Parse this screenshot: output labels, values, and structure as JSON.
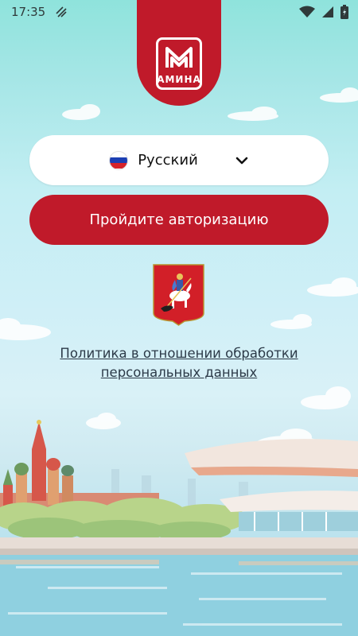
{
  "status_bar": {
    "time": "17:35",
    "left_icon": "no-sim-icon",
    "right_icons": [
      "wifi-icon",
      "signal-icon",
      "battery-icon"
    ]
  },
  "logo": {
    "icon": "amina-logo-icon",
    "text": "АМИНА",
    "color": "#c01a2a"
  },
  "language_selector": {
    "flag_icon": "russia-flag-icon",
    "label": "Русский",
    "chevron_icon": "chevron-down-icon"
  },
  "auth_button": {
    "label": "Пройдите авторизацию",
    "color": "#c01a2a"
  },
  "emblem": {
    "icon": "moscow-coat-of-arms-icon"
  },
  "policy_link": {
    "line1": "Политика в отношении обработки",
    "line2": "персональных данных"
  }
}
